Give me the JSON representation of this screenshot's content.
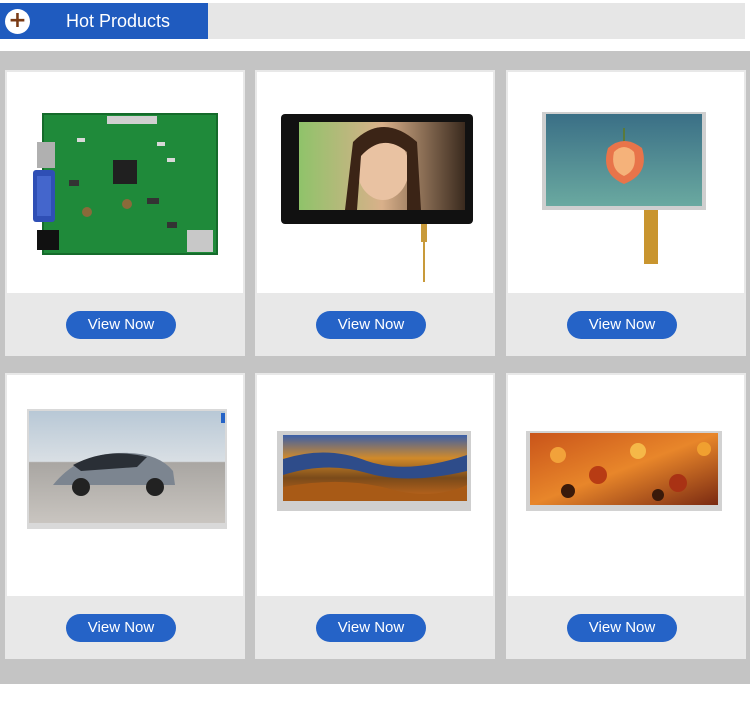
{
  "header": {
    "title": "Hot Products",
    "icon": "plus-icon",
    "accent": "#1f5bbf",
    "bar_color": "#e6e6e6"
  },
  "products": [
    {
      "button_label": "View Now",
      "image": "pcb-controller-board"
    },
    {
      "button_label": "View Now",
      "image": "touch-screen-panel-woman"
    },
    {
      "button_label": "View Now",
      "image": "lcd-panel-flower"
    },
    {
      "button_label": "View Now",
      "image": "lcd-panel-sports-car"
    },
    {
      "button_label": "View Now",
      "image": "bar-lcd-landscape"
    },
    {
      "button_label": "View Now",
      "image": "bar-lcd-autumn-leaves"
    }
  ],
  "colors": {
    "button": "#2563c7",
    "grid_background": "#c4c4c4",
    "card_background": "#e8e8e8"
  }
}
